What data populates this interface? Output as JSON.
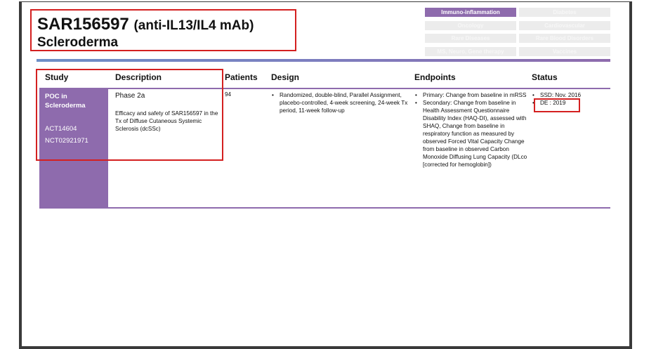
{
  "header": {
    "title_code": "SAR156597",
    "title_desc": "(anti-IL13/IL4 mAb)",
    "indication": "Scleroderma"
  },
  "therapeutic_areas": [
    {
      "label": "Immuno-inflammation",
      "active": true
    },
    {
      "label": "Diabetes",
      "active": false
    },
    {
      "label": "Oncology",
      "active": false
    },
    {
      "label": "Cardiovascular",
      "active": false
    },
    {
      "label": "Rare Diseases",
      "active": false
    },
    {
      "label": "Rare Blood Disorders",
      "active": false
    },
    {
      "label": "MS, Neuro, Gene therapy",
      "active": false
    },
    {
      "label": "Vaccines",
      "active": false
    }
  ],
  "table": {
    "headers": {
      "study": "Study",
      "description": "Description",
      "patients": "Patients",
      "design": "Design",
      "endpoints": "Endpoints",
      "status": "Status"
    },
    "row": {
      "study_title": "POC in Scleroderma",
      "study_id_1": "ACT14604",
      "study_id_2": "NCT02921971",
      "phase": "Phase 2a",
      "description": "Efficacy and safety of SAR156597 in the Tx of Diffuse Cutaneous Systemic Sclerosis (dcSSc)",
      "patients": "94",
      "design": [
        "Randomized, double-blind, Parallel Assignment, placebo-controlled, 4-week screening, 24-week Tx period, 11-week follow-up"
      ],
      "endpoints": [
        "Primary: Change from baseline in mRSS",
        "Secondary: Change from baseline in Health Assessment Questionnaire Disability Index (HAQ-DI), assessed with SHAQ, Change from baseline in respiratory function as measured by observed Forced Vital Capacity Change from baseline in observed Carbon Monoxide Diffusing Lung Capacity (DLco [corrected for hemoglobin])"
      ],
      "status": [
        "SSD: Nov. 2016",
        "DE : 2019"
      ]
    }
  },
  "colors": {
    "accent_purple": "#8e6bad",
    "highlight_red": "#d42020"
  }
}
